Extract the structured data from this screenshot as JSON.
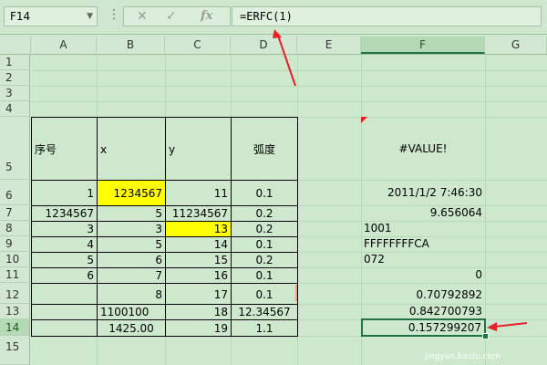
{
  "namebox": {
    "value": "F14"
  },
  "formula_bar": {
    "fx_label": "fx",
    "formula": "=ERFC(1)"
  },
  "columns": [
    "A",
    "B",
    "C",
    "D",
    "E",
    "F",
    "G"
  ],
  "rows": [
    "1",
    "2",
    "3",
    "4",
    "5",
    "6",
    "7",
    "8",
    "9",
    "10",
    "11",
    "12",
    "13",
    "14",
    "15"
  ],
  "table": {
    "headers": [
      "序号",
      "x",
      "y",
      "弧度"
    ],
    "rows": [
      [
        "1",
        "1234567",
        "11",
        "0.1"
      ],
      [
        "1234567",
        "5",
        "11234567",
        "0.2"
      ],
      [
        "3",
        "3",
        "13",
        "0.2"
      ],
      [
        "4",
        "5",
        "14",
        "0.1"
      ],
      [
        "5",
        "6",
        "15",
        "0.2"
      ],
      [
        "6",
        "7",
        "16",
        "0.1"
      ],
      [
        "",
        "8",
        "17",
        "0.1"
      ],
      [
        "",
        "1100100",
        "18",
        "12.34567"
      ],
      [
        "",
        "1425.00",
        "19",
        "1.1"
      ]
    ]
  },
  "f_column": {
    "r5": "#VALUE!",
    "r6": "2011/1/2 7:46:30",
    "r7": "9.656064",
    "r8": "1001",
    "r9": "FFFFFFFFCA",
    "r10": "072",
    "r11": "0",
    "r12": "0.70792892",
    "r13": "0.842700793",
    "r14": "0.157299207"
  },
  "watermark": "jingyan.baidu.com",
  "colors": {
    "highlight": "#ffff00",
    "selection": "#217346",
    "annotation": "#e8202a"
  }
}
